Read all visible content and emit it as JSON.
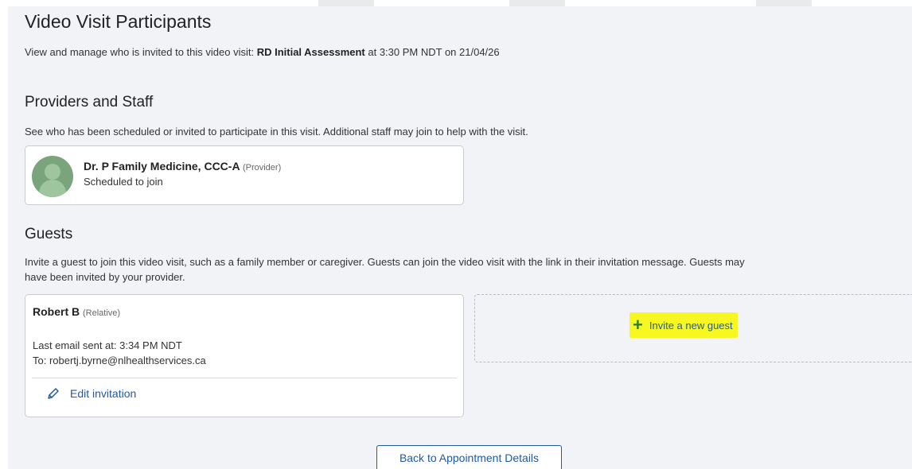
{
  "page": {
    "title": "Video Visit Participants",
    "subtitle_prefix": "View and manage who is invited to this video visit: ",
    "visit_name": "RD Initial Assessment",
    "subtitle_suffix": " at 3:30 PM NDT on 21/04/26"
  },
  "providers": {
    "title": "Providers and Staff",
    "description": "See who has been scheduled or invited to participate in this visit. Additional staff may join to help with the visit.",
    "items": [
      {
        "name": "Dr. P Family Medicine, CCC-A",
        "role": "(Provider)",
        "status": "Scheduled to join"
      }
    ]
  },
  "guests": {
    "title": "Guests",
    "description_line1": "Invite a guest to join this video visit, such as a family member or caregiver. Guests can join the video visit with the link in their invitation message. Guests may",
    "description_line2": "have been invited by your provider.",
    "items": [
      {
        "name": "Robert B",
        "role": "(Relative)",
        "last_email": "Last email sent at: 3:34 PM NDT",
        "to": "To: robertj.byrne@nlhealthservices.ca",
        "edit_label": "Edit invitation"
      }
    ],
    "invite_label": "Invite a new guest",
    "invite_highlight_color": "#f7f722"
  },
  "footer": {
    "back_label": "Back to Appointment Details"
  },
  "colors": {
    "link": "#1f5aa6",
    "plus": "#2e7d32",
    "panel_bg": "#f1f3f6"
  }
}
